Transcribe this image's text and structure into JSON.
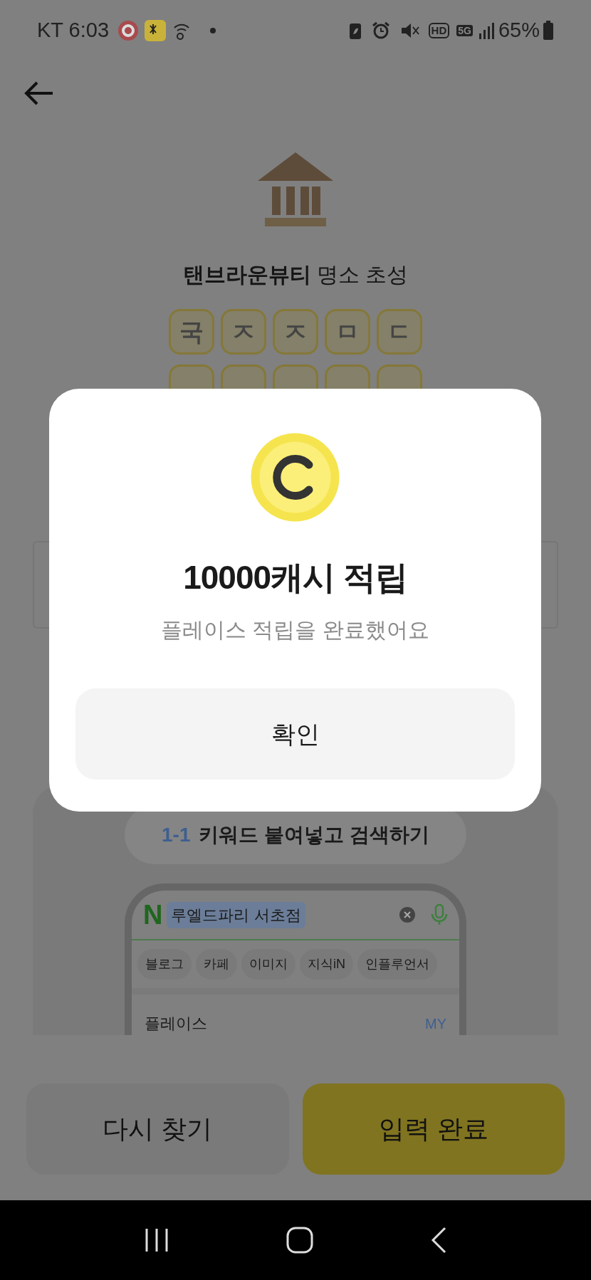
{
  "status_bar": {
    "carrier_time": "KT 6:03",
    "hd": "HD",
    "network": "5G",
    "battery": "65%"
  },
  "place": {
    "name": "탠브라운뷰티",
    "suffix": "명소 초성"
  },
  "tiles": [
    "국",
    "ㅈ",
    "ㅈ",
    "ㅁ",
    "ㄷ"
  ],
  "guide": {
    "step": "1-1",
    "logo": "N",
    "title": "키워드 붙여넣고 검색하기",
    "search_query": "루엘드파리 서초점",
    "filters": [
      "블로그",
      "카페",
      "이미지",
      "지식iN",
      "인플루언서"
    ],
    "section": "플레이스",
    "section_link": "MY"
  },
  "modal": {
    "title": "10000캐시 적립",
    "message": "플레이스 적립을 완료했어요",
    "button": "확인"
  },
  "buttons": [
    {
      "label": "다시 찾기",
      "kind": "secondary"
    },
    {
      "label": "입력 완료",
      "kind": "primary"
    }
  ]
}
